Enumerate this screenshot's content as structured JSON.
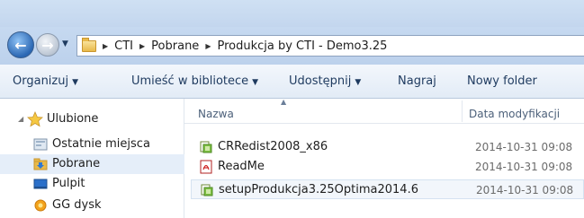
{
  "address": {
    "crumbs": [
      "CTI",
      "Pobrane",
      "Produkcja by CTI - Demo3.25"
    ]
  },
  "toolbar": {
    "organize_label": "Organizuj",
    "library_label": "Umieść w bibliotece",
    "share_label": "Udostępnij",
    "burn_label": "Nagraj",
    "new_folder_label": "Nowy folder"
  },
  "navpane": {
    "favorites_label": "Ulubione",
    "items": [
      {
        "label": "Ostatnie miejsca"
      },
      {
        "label": "Pobrane"
      },
      {
        "label": "Pulpit"
      },
      {
        "label": "GG dysk"
      }
    ]
  },
  "columns": {
    "name": "Nazwa",
    "date_modified": "Data modyfikacji"
  },
  "files": [
    {
      "name": "CRRedist2008_x86",
      "date": "2014-10-31 09:08",
      "icon": "installer-icon"
    },
    {
      "name": "ReadMe",
      "date": "2014-10-31 09:08",
      "icon": "pdf-icon"
    },
    {
      "name": "setupProdukcja3.25Optima2014.6",
      "date": "2014-10-31 09:08",
      "icon": "installer-icon"
    }
  ],
  "colors": {
    "selection": "#e5eef9",
    "toolbar_text": "#1e3a5f",
    "date_text": "#6b6b6b"
  }
}
